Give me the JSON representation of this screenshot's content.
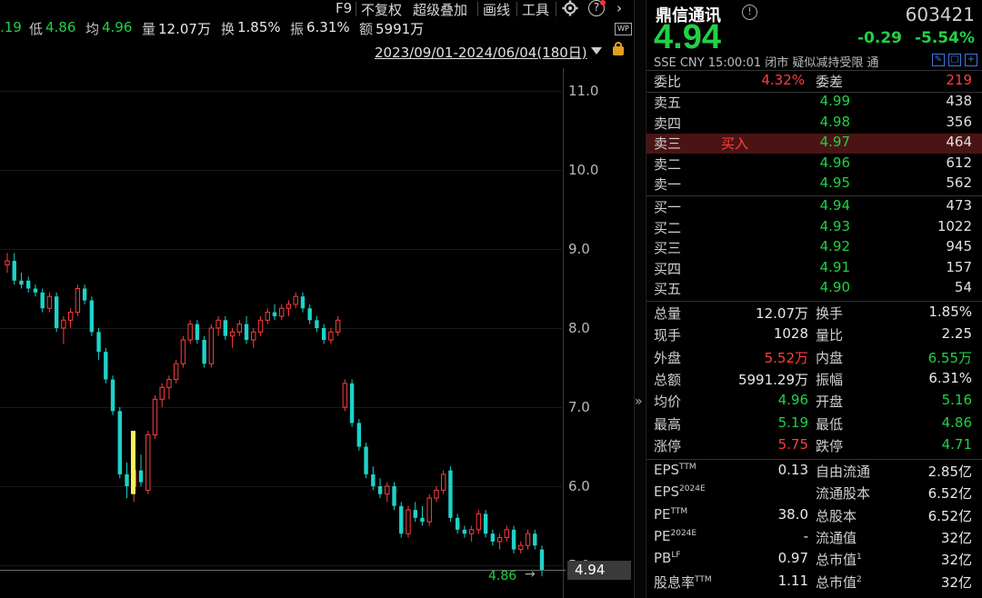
{
  "toolbar": {
    "f9": "F9",
    "adjust": "不复权",
    "overlay": "超级叠加",
    "draw": "画线",
    "tools": "工具",
    "help": "?"
  },
  "stats": {
    "high_partial": ".19",
    "low_label": "低",
    "low_value": "4.86",
    "avg_label": "均",
    "avg_value": "4.96",
    "vol_label": "量",
    "vol_value": "12.07万",
    "turnover_label": "换",
    "turnover_value": "1.85%",
    "amp_label": "振",
    "amp_value": "6.31%",
    "amount_label": "额",
    "amount_value": "5991万"
  },
  "date_range": "2023/09/01-2024/06/04(180日)",
  "wp_badge": "WP",
  "chart_data": {
    "type": "candlestick",
    "y_ticks": [
      "11.0",
      "10.0",
      "9.0",
      "8.0",
      "7.0",
      "6.0",
      "5.0"
    ],
    "ylim": [
      4.5,
      11.3
    ],
    "last_price_label": "4.94",
    "low_marker_label": "4.86",
    "candles": [
      [
        8.8,
        8.95,
        8.7,
        8.85
      ],
      [
        8.85,
        8.95,
        8.55,
        8.6
      ],
      [
        8.6,
        8.7,
        8.5,
        8.55
      ],
      [
        8.6,
        8.65,
        8.45,
        8.5
      ],
      [
        8.5,
        8.55,
        8.4,
        8.45
      ],
      [
        8.45,
        8.5,
        8.2,
        8.25
      ],
      [
        8.25,
        8.45,
        8.2,
        8.4
      ],
      [
        8.4,
        8.45,
        7.95,
        8.0
      ],
      [
        8.0,
        8.15,
        7.8,
        8.1
      ],
      [
        8.1,
        8.25,
        8.0,
        8.2
      ],
      [
        8.2,
        8.55,
        8.15,
        8.5
      ],
      [
        8.5,
        8.55,
        8.3,
        8.35
      ],
      [
        8.35,
        8.4,
        7.9,
        7.95
      ],
      [
        7.95,
        8.0,
        7.6,
        7.7
      ],
      [
        7.7,
        7.75,
        7.3,
        7.35
      ],
      [
        7.35,
        7.4,
        6.9,
        6.95
      ],
      [
        6.95,
        7.0,
        6.1,
        6.15
      ],
      [
        6.15,
        6.3,
        5.85,
        6.0
      ],
      [
        6.0,
        6.25,
        5.8,
        6.2
      ],
      [
        6.2,
        6.4,
        6.0,
        6.05
      ],
      [
        5.95,
        6.7,
        5.9,
        6.65
      ],
      [
        6.65,
        7.15,
        6.6,
        7.1
      ],
      [
        7.1,
        7.3,
        7.0,
        7.25
      ],
      [
        7.25,
        7.4,
        7.1,
        7.35
      ],
      [
        7.35,
        7.6,
        7.3,
        7.55
      ],
      [
        7.55,
        7.9,
        7.5,
        7.85
      ],
      [
        7.85,
        8.1,
        7.8,
        8.05
      ],
      [
        8.05,
        8.1,
        7.8,
        7.85
      ],
      [
        7.85,
        7.9,
        7.5,
        7.55
      ],
      [
        7.55,
        8.05,
        7.5,
        8.0
      ],
      [
        8.0,
        8.15,
        7.9,
        8.1
      ],
      [
        8.1,
        8.15,
        7.85,
        7.9
      ],
      [
        7.9,
        8.0,
        7.75,
        7.95
      ],
      [
        7.95,
        8.1,
        7.9,
        8.05
      ],
      [
        8.05,
        8.15,
        7.8,
        7.85
      ],
      [
        7.85,
        8.0,
        7.75,
        7.95
      ],
      [
        7.95,
        8.15,
        7.9,
        8.1
      ],
      [
        8.1,
        8.25,
        8.05,
        8.2
      ],
      [
        8.2,
        8.3,
        8.1,
        8.15
      ],
      [
        8.15,
        8.3,
        8.1,
        8.25
      ],
      [
        8.25,
        8.35,
        8.15,
        8.3
      ],
      [
        8.3,
        8.45,
        8.25,
        8.4
      ],
      [
        8.4,
        8.45,
        8.2,
        8.25
      ],
      [
        8.25,
        8.3,
        8.05,
        8.1
      ],
      [
        8.1,
        8.15,
        7.95,
        8.0
      ],
      [
        8.0,
        8.05,
        7.8,
        7.85
      ],
      [
        7.85,
        8.0,
        7.8,
        7.95
      ],
      [
        7.95,
        8.15,
        7.9,
        8.1
      ],
      [
        7.0,
        7.35,
        6.95,
        7.3
      ],
      [
        7.3,
        7.35,
        6.75,
        6.8
      ],
      [
        6.8,
        6.85,
        6.45,
        6.5
      ],
      [
        6.5,
        6.55,
        6.1,
        6.15
      ],
      [
        6.15,
        6.25,
        5.95,
        6.0
      ],
      [
        6.0,
        6.1,
        5.85,
        5.9
      ],
      [
        5.9,
        6.05,
        5.8,
        6.0
      ],
      [
        6.0,
        6.05,
        5.7,
        5.75
      ],
      [
        5.75,
        5.8,
        5.35,
        5.4
      ],
      [
        5.4,
        5.75,
        5.35,
        5.7
      ],
      [
        5.7,
        5.8,
        5.55,
        5.6
      ],
      [
        5.6,
        5.75,
        5.5,
        5.55
      ],
      [
        5.55,
        5.9,
        5.5,
        5.85
      ],
      [
        5.85,
        6.0,
        5.8,
        5.95
      ],
      [
        5.95,
        6.2,
        5.9,
        6.15
      ],
      [
        6.2,
        6.25,
        5.55,
        5.6
      ],
      [
        5.6,
        5.65,
        5.4,
        5.45
      ],
      [
        5.45,
        5.5,
        5.35,
        5.4
      ],
      [
        5.4,
        5.5,
        5.3,
        5.45
      ],
      [
        5.45,
        5.7,
        5.4,
        5.65
      ],
      [
        5.65,
        5.7,
        5.35,
        5.4
      ],
      [
        5.4,
        5.45,
        5.25,
        5.3
      ],
      [
        5.3,
        5.4,
        5.2,
        5.35
      ],
      [
        5.35,
        5.5,
        5.3,
        5.45
      ],
      [
        5.45,
        5.5,
        5.15,
        5.2
      ],
      [
        5.2,
        5.3,
        5.15,
        5.25
      ],
      [
        5.25,
        5.45,
        5.2,
        5.4
      ],
      [
        5.4,
        5.45,
        5.2,
        5.25
      ],
      [
        5.2,
        5.25,
        4.86,
        4.94
      ]
    ]
  },
  "quote": {
    "name": "鼎信通讯",
    "code": "603421",
    "price": "4.94",
    "change": "-0.29",
    "change_pct": "-5.54%",
    "meta": "SSE  CNY  15:00:01  闭市 疑似减持受限  通",
    "webi_label": "委比",
    "webi_value": "4.32%",
    "weicha_label": "委差",
    "weicha_value": "219",
    "asks": [
      {
        "label": "卖五",
        "price": "4.99",
        "vol": "438"
      },
      {
        "label": "卖四",
        "price": "4.98",
        "vol": "356"
      },
      {
        "label": "卖三",
        "price": "4.97",
        "vol": "464",
        "mark": "买入"
      },
      {
        "label": "卖二",
        "price": "4.96",
        "vol": "612"
      },
      {
        "label": "卖一",
        "price": "4.95",
        "vol": "562"
      }
    ],
    "bids": [
      {
        "label": "买一",
        "price": "4.94",
        "vol": "473"
      },
      {
        "label": "买二",
        "price": "4.93",
        "vol": "1022"
      },
      {
        "label": "买三",
        "price": "4.92",
        "vol": "945"
      },
      {
        "label": "买四",
        "price": "4.91",
        "vol": "157"
      },
      {
        "label": "买五",
        "price": "4.90",
        "vol": "54"
      }
    ],
    "stats": [
      {
        "l1": "总量",
        "v1": "12.07万",
        "c1": "white",
        "l2": "换手",
        "v2": "1.85%",
        "c2": "white"
      },
      {
        "l1": "现手",
        "v1": "1028",
        "c1": "white",
        "l2": "量比",
        "v2": "2.25",
        "c2": "white"
      },
      {
        "l1": "外盘",
        "v1": "5.52万",
        "c1": "red",
        "l2": "内盘",
        "v2": "6.55万",
        "c2": "green"
      },
      {
        "l1": "总额",
        "v1": "5991.29万",
        "c1": "white",
        "l2": "振幅",
        "v2": "6.31%",
        "c2": "white"
      },
      {
        "l1": "均价",
        "v1": "4.96",
        "c1": "green",
        "l2": "开盘",
        "v2": "5.16",
        "c2": "green"
      },
      {
        "l1": "最高",
        "v1": "5.19",
        "c1": "green",
        "l2": "最低",
        "v2": "4.86",
        "c2": "green"
      },
      {
        "l1": "涨停",
        "v1": "5.75",
        "c1": "red",
        "l2": "跌停",
        "v2": "4.71",
        "c2": "green"
      }
    ],
    "fundamentals": [
      {
        "l1": "EPS",
        "s1": "TTM",
        "v1": "0.13",
        "l2": "自由流通",
        "s2": "",
        "v2": "2.85亿"
      },
      {
        "l1": "EPS",
        "s1": "2024E",
        "v1": "",
        "l2": "流通股本",
        "s2": "",
        "v2": "6.52亿"
      },
      {
        "l1": "PE",
        "s1": "TTM",
        "v1": "38.0",
        "l2": "总股本",
        "s2": "",
        "v2": "6.52亿"
      },
      {
        "l1": "PE",
        "s1": "2024E",
        "v1": "-",
        "l2": "流通值",
        "s2": "",
        "v2": "32亿"
      },
      {
        "l1": "PB",
        "s1": "LF",
        "v1": "0.97",
        "l2": "总市值",
        "s2": "1",
        "v2": "32亿"
      },
      {
        "l1": "股息率",
        "s1": "TTM",
        "v1": "1.11",
        "l2": "总市值",
        "s2": "2",
        "v2": "32亿"
      }
    ]
  }
}
